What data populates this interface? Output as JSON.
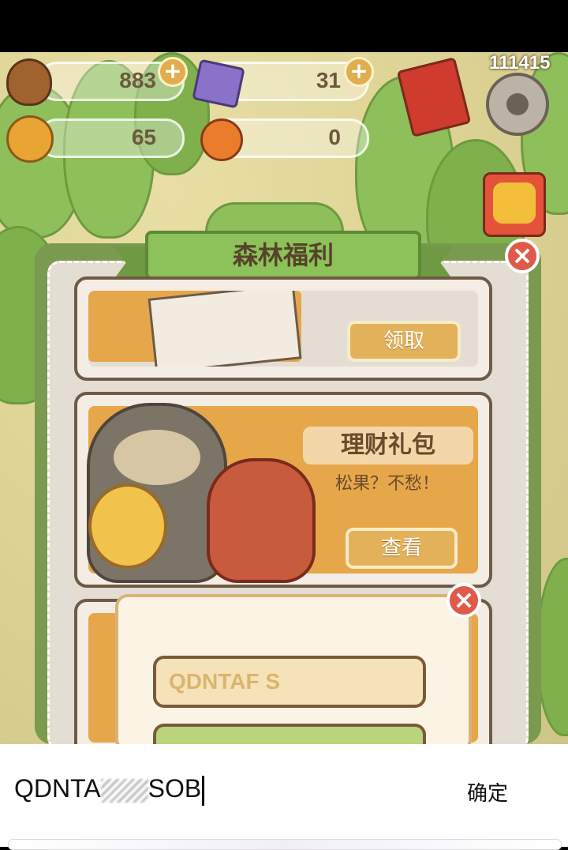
{
  "resources": {
    "acorns": {
      "value": "883",
      "icon": "acorn-icon"
    },
    "gems": {
      "value": "31",
      "icon": "gem-icon"
    },
    "bells": {
      "value": "65",
      "icon": "bell-icon"
    },
    "oranges": {
      "value": "0",
      "icon": "orange-icon"
    }
  },
  "player_id": "111415",
  "panel": {
    "title": "森林福利",
    "cards": [
      {
        "button": "领取"
      },
      {
        "tag": "理财礼包",
        "subtitle": "松果？不愁！",
        "button": "查看"
      }
    ]
  },
  "redeem_dialog": {
    "code_value": "QDNTAF  S"
  },
  "keyboard": {
    "input_text_start": "QDNTA",
    "input_text_end": "SOB",
    "confirm_label": "确定"
  },
  "colors": {
    "panel_green": "#7a9a50",
    "button_gold": "#e2b15a",
    "close_red": "#e05a4a"
  }
}
